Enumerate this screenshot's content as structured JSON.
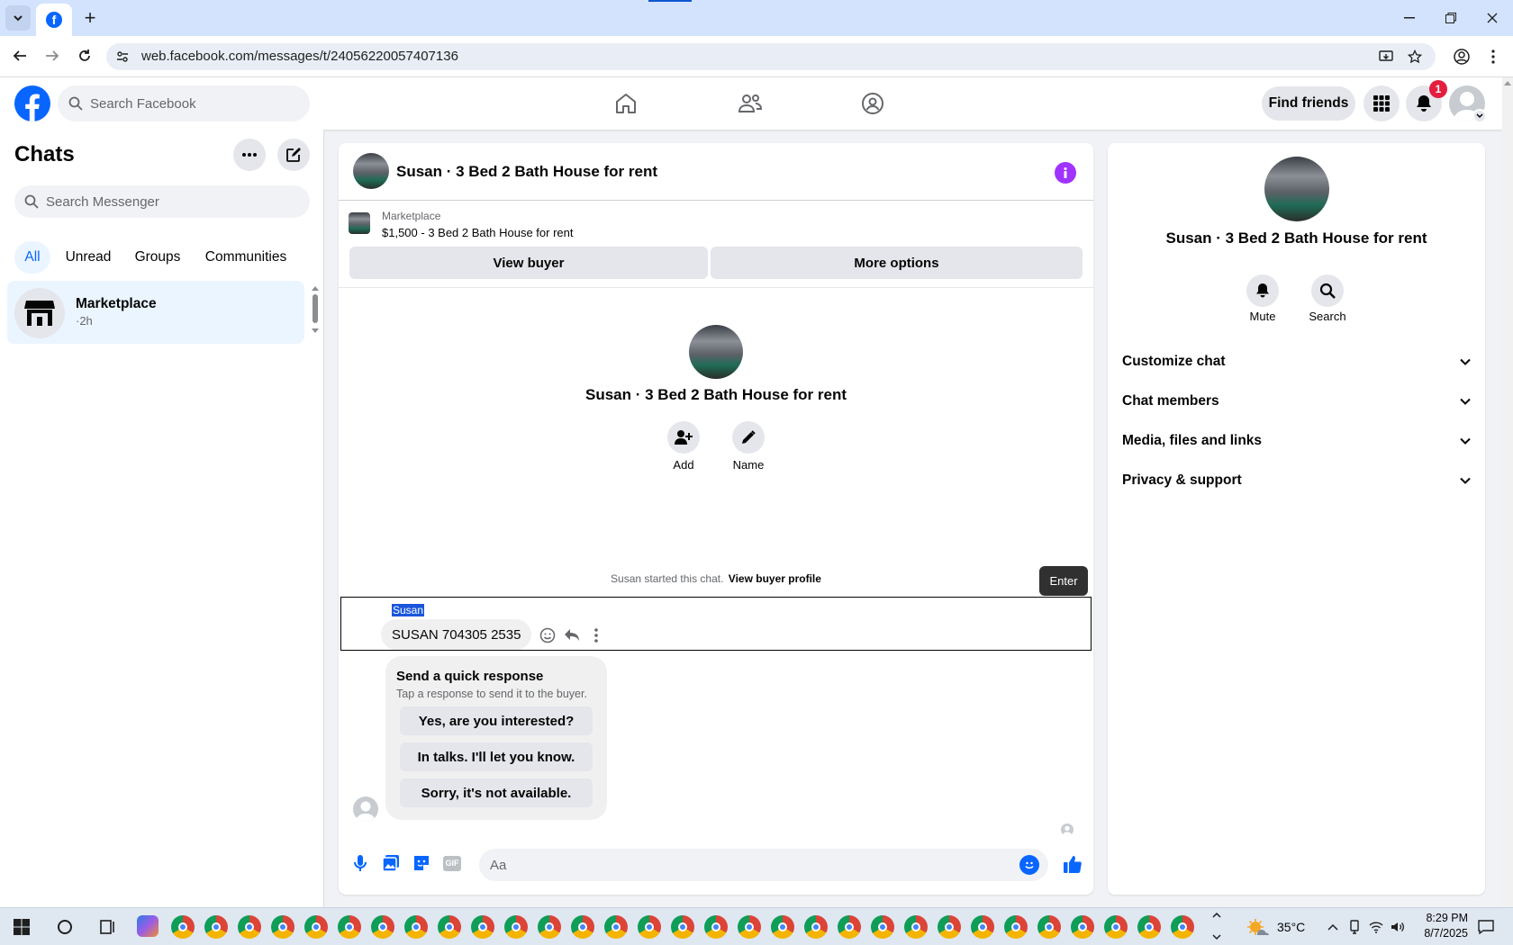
{
  "browser": {
    "url": "web.facebook.com/messages/t/24056220057407136"
  },
  "header": {
    "search_placeholder": "Search Facebook",
    "find_friends": "Find friends",
    "notification_count": "1"
  },
  "sidebar": {
    "title": "Chats",
    "search_placeholder": "Search Messenger",
    "filters": [
      "All",
      "Unread",
      "Groups",
      "Communities"
    ],
    "chats": [
      {
        "name": "Marketplace",
        "time": "·2h"
      }
    ]
  },
  "chat": {
    "title": "Susan · 3 Bed 2 Bath House for rent",
    "listing_source": "Marketplace",
    "listing_detail": "$1,500 - 3 Bed 2 Bath House for rent",
    "view_buyer": "View buyer",
    "more_options": "More options",
    "intro_name": "Susan · 3 Bed 2 Bath House for rent",
    "add_label": "Add",
    "name_label": "Name",
    "started_text": "Susan started this chat.",
    "view_buyer_profile": "View buyer profile",
    "tooltip": "Enter",
    "sender_name": "Susan",
    "message": "SUSAN 704305 2535",
    "quick_title": "Send a quick response",
    "quick_subtitle": "Tap a response to send it to the buyer.",
    "quick_responses": [
      "Yes, are you interested?",
      "In talks. I'll let you know.",
      "Sorry, it's not available."
    ],
    "composer_placeholder": "Aa"
  },
  "info_panel": {
    "name": "Susan · 3 Bed 2 Bath House for rent",
    "mute": "Mute",
    "search": "Search",
    "sections": [
      "Customize chat",
      "Chat members",
      "Media, files and links",
      "Privacy & support"
    ]
  },
  "taskbar": {
    "temperature": "35°C",
    "time": "8:29 PM",
    "date": "8/7/2025"
  },
  "colors": {
    "facebook_blue": "#0866ff",
    "messenger_purple": "#a033ff",
    "notification_red": "#e41e3f"
  }
}
